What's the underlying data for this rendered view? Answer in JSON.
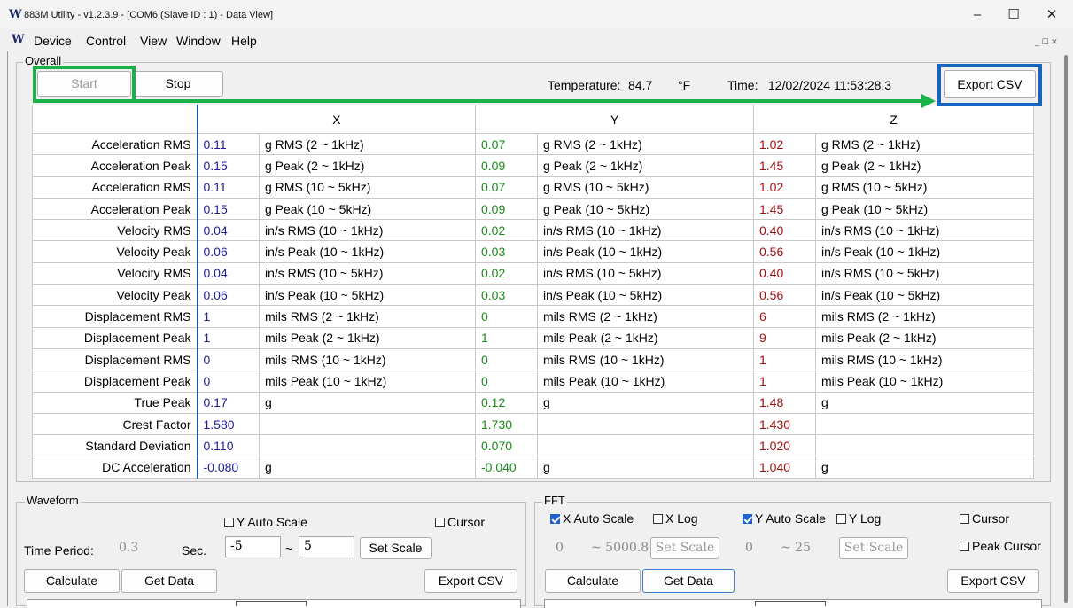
{
  "window": {
    "title": "883M Utility - v1.2.3.9 - [COM6 (Slave ID : 1) - Data View]",
    "logo": "W",
    "controls": {
      "minimize": "–",
      "maximize": "☐",
      "close": "✕"
    }
  },
  "menu": {
    "logo": "W",
    "items": [
      "Device",
      "Control",
      "View",
      "Window",
      "Help"
    ],
    "mdi_controls": "_ ☐ ✕"
  },
  "overall": {
    "label": "Overall",
    "start_label": "Start",
    "stop_label": "Stop",
    "temperature_label": "Temperature:",
    "temperature_value": "84.7",
    "temperature_unit": "°F",
    "time_label": "Time:",
    "time_value": "12/02/2024 11:53:28.3",
    "export_label": "Export CSV",
    "columns": [
      "",
      "X",
      "Y",
      "Z"
    ],
    "rows": [
      {
        "name": "Acceleration RMS",
        "x": "0.11",
        "xu": "g  RMS (2 ~ 1kHz)",
        "y": "0.07",
        "yu": "g  RMS (2 ~ 1kHz)",
        "z": "1.02",
        "zu": "g  RMS (2 ~ 1kHz)"
      },
      {
        "name": "Acceleration Peak",
        "x": "0.15",
        "xu": "g  Peak (2 ~ 1kHz)",
        "y": "0.09",
        "yu": "g  Peak (2 ~ 1kHz)",
        "z": "1.45",
        "zu": "g  Peak (2 ~ 1kHz)"
      },
      {
        "name": "Acceleration RMS",
        "x": "0.11",
        "xu": "g  RMS (10 ~ 5kHz)",
        "y": "0.07",
        "yu": "g  RMS (10 ~ 5kHz)",
        "z": "1.02",
        "zu": "g  RMS (10 ~ 5kHz)"
      },
      {
        "name": "Acceleration Peak",
        "x": "0.15",
        "xu": "g  Peak (10 ~ 5kHz)",
        "y": "0.09",
        "yu": "g  Peak (10 ~ 5kHz)",
        "z": "1.45",
        "zu": "g  Peak (10 ~ 5kHz)"
      },
      {
        "name": "Velocity RMS",
        "x": "0.04",
        "xu": "in/s  RMS (10 ~ 1kHz)",
        "y": "0.02",
        "yu": "in/s  RMS (10 ~ 1kHz)",
        "z": "0.40",
        "zu": "in/s  RMS (10 ~ 1kHz)"
      },
      {
        "name": "Velocity Peak",
        "x": "0.06",
        "xu": "in/s  Peak (10 ~ 1kHz)",
        "y": "0.03",
        "yu": "in/s  Peak (10 ~ 1kHz)",
        "z": "0.56",
        "zu": "in/s  Peak (10 ~ 1kHz)"
      },
      {
        "name": "Velocity RMS",
        "x": "0.04",
        "xu": "in/s  RMS (10 ~ 5kHz)",
        "y": "0.02",
        "yu": "in/s  RMS (10 ~ 5kHz)",
        "z": "0.40",
        "zu": "in/s  RMS (10 ~ 5kHz)"
      },
      {
        "name": "Velocity Peak",
        "x": "0.06",
        "xu": "in/s  Peak (10 ~ 5kHz)",
        "y": "0.03",
        "yu": "in/s  Peak (10 ~ 5kHz)",
        "z": "0.56",
        "zu": "in/s  Peak (10 ~ 5kHz)"
      },
      {
        "name": "Displacement RMS",
        "x": "1",
        "xu": "mils  RMS (2 ~ 1kHz)",
        "y": "0",
        "yu": "mils  RMS (2 ~ 1kHz)",
        "z": "6",
        "zu": "mils  RMS (2 ~ 1kHz)"
      },
      {
        "name": "Displacement Peak",
        "x": "1",
        "xu": "mils  Peak (2 ~ 1kHz)",
        "y": "1",
        "yu": "mils  Peak (2 ~ 1kHz)",
        "z": "9",
        "zu": "mils  Peak (2 ~ 1kHz)"
      },
      {
        "name": "Displacement RMS",
        "x": "0",
        "xu": "mils  RMS (10 ~ 1kHz)",
        "y": "0",
        "yu": "mils  RMS (10 ~ 1kHz)",
        "z": "1",
        "zu": "mils  RMS (10 ~ 1kHz)"
      },
      {
        "name": "Displacement Peak",
        "x": "0",
        "xu": "mils  Peak (10 ~ 1kHz)",
        "y": "0",
        "yu": "mils  Peak (10 ~ 1kHz)",
        "z": "1",
        "zu": "mils  Peak (10 ~ 1kHz)"
      },
      {
        "name": "True Peak",
        "x": "0.17",
        "xu": "g",
        "y": "0.12",
        "yu": "g",
        "z": "1.48",
        "zu": "g"
      },
      {
        "name": "Crest Factor",
        "x": "1.580",
        "xu": "",
        "y": "1.730",
        "yu": "",
        "z": "1.430",
        "zu": ""
      },
      {
        "name": "Standard Deviation",
        "x": "0.110",
        "xu": "",
        "y": "0.070",
        "yu": "",
        "z": "1.020",
        "zu": ""
      },
      {
        "name": "DC Acceleration",
        "x": "-0.080",
        "xu": "g",
        "y": "-0.040",
        "yu": "g",
        "z": "1.040",
        "zu": "g"
      }
    ]
  },
  "waveform": {
    "label": "Waveform",
    "y_auto_scale": "Y Auto Scale",
    "cursor": "Cursor",
    "time_period_label": "Time Period:",
    "time_period_value": "0.3",
    "sec_label": "Sec.",
    "range_min": "-5",
    "tilde": "~",
    "range_max": "5",
    "set_scale": "Set Scale",
    "calculate": "Calculate",
    "get_data": "Get Data",
    "export_csv": "Export CSV"
  },
  "fft": {
    "label": "FFT",
    "x_auto_scale": "X Auto Scale",
    "x_log": "X Log",
    "y_auto_scale": "Y Auto Scale",
    "y_log": "Y Log",
    "cursor": "Cursor",
    "peak_cursor": "Peak Cursor",
    "x_min": "0",
    "x_max": "~ 5000.8",
    "y_min": "0",
    "y_max": "~ 25",
    "set_scale": "Set Scale",
    "calculate": "Calculate",
    "get_data": "Get Data",
    "export_csv": "Export CSV"
  }
}
